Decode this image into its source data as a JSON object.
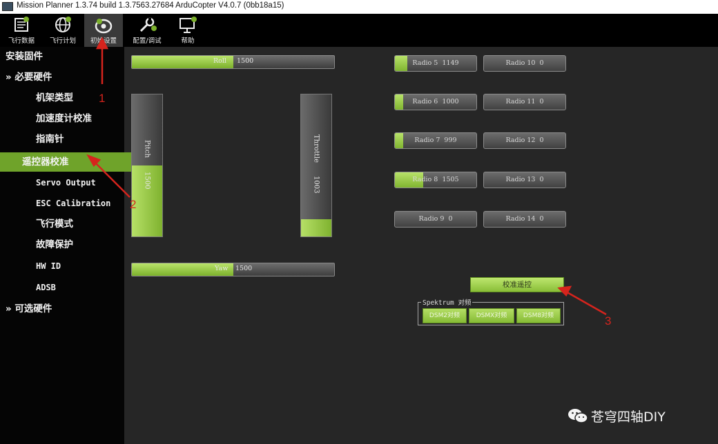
{
  "window": {
    "title": "Mission Planner 1.3.74 build 1.3.7563.27684 ArduCopter V4.0.7 (0bb18a15)"
  },
  "toolbar": {
    "buttons": [
      {
        "label": "飞行数据",
        "icon": "flight-data-icon"
      },
      {
        "label": "飞行计划",
        "icon": "globe-icon"
      },
      {
        "label": "初始设置",
        "icon": "initial-setup-icon"
      },
      {
        "label": "配置/调试",
        "icon": "wrench-icon"
      },
      {
        "label": "帮助",
        "icon": "monitor-help-icon"
      }
    ],
    "active_index": 2
  },
  "sidebar": {
    "items": [
      {
        "label": "安装固件",
        "level": "top"
      },
      {
        "label": "» 必要硬件",
        "level": "top"
      },
      {
        "label": "机架类型",
        "level": "sub"
      },
      {
        "label": "加速度计校准",
        "level": "sub"
      },
      {
        "label": "指南针",
        "level": "sub"
      },
      {
        "label": "遥控器校准",
        "level": "sub",
        "selected": true
      },
      {
        "label": "Servo Output",
        "level": "sub"
      },
      {
        "label": "ESC Calibration",
        "level": "sub"
      },
      {
        "label": "飞行模式",
        "level": "sub"
      },
      {
        "label": "故障保护",
        "level": "sub"
      },
      {
        "label": "HW ID",
        "level": "sub"
      },
      {
        "label": "ADSB",
        "level": "sub"
      },
      {
        "label": "» 可选硬件",
        "level": "top"
      }
    ]
  },
  "controls": {
    "roll": {
      "label": "Roll",
      "value": "1500",
      "fraction": 0.5
    },
    "pitch": {
      "label": "Pitch",
      "value": "1500",
      "fraction": 0.5
    },
    "throttle": {
      "label": "Throttle",
      "value": "1003",
      "fraction": 0.12
    },
    "yaw": {
      "label": "Yaw",
      "value": "1500",
      "fraction": 0.5
    }
  },
  "radios": [
    {
      "label": "Radio 5",
      "value": "1149",
      "fraction": 0.15
    },
    {
      "label": "Radio 6",
      "value": "1000",
      "fraction": 0.1
    },
    {
      "label": "Radio 7",
      "value": "999",
      "fraction": 0.1
    },
    {
      "label": "Radio 8",
      "value": "1505",
      "fraction": 0.35
    },
    {
      "label": "Radio 9",
      "value": "0",
      "fraction": 0
    },
    {
      "label": "Radio 10",
      "value": "0",
      "fraction": 0
    },
    {
      "label": "Radio 11",
      "value": "0",
      "fraction": 0
    },
    {
      "label": "Radio 12",
      "value": "0",
      "fraction": 0
    },
    {
      "label": "Radio 13",
      "value": "0",
      "fraction": 0
    },
    {
      "label": "Radio 14",
      "value": "0",
      "fraction": 0
    }
  ],
  "calibrate_button": "校准遥控",
  "spektrum": {
    "legend": "Spektrum 对频",
    "buttons": [
      "DSM2对频",
      "DSMX对频",
      "DSM8对频"
    ]
  },
  "annotations": [
    "1",
    "2",
    "3"
  ],
  "watermark": "苍穹四轴DIY",
  "colors": {
    "accent": "#7cb12c",
    "annotation": "#d6241d",
    "background": "#262626"
  }
}
